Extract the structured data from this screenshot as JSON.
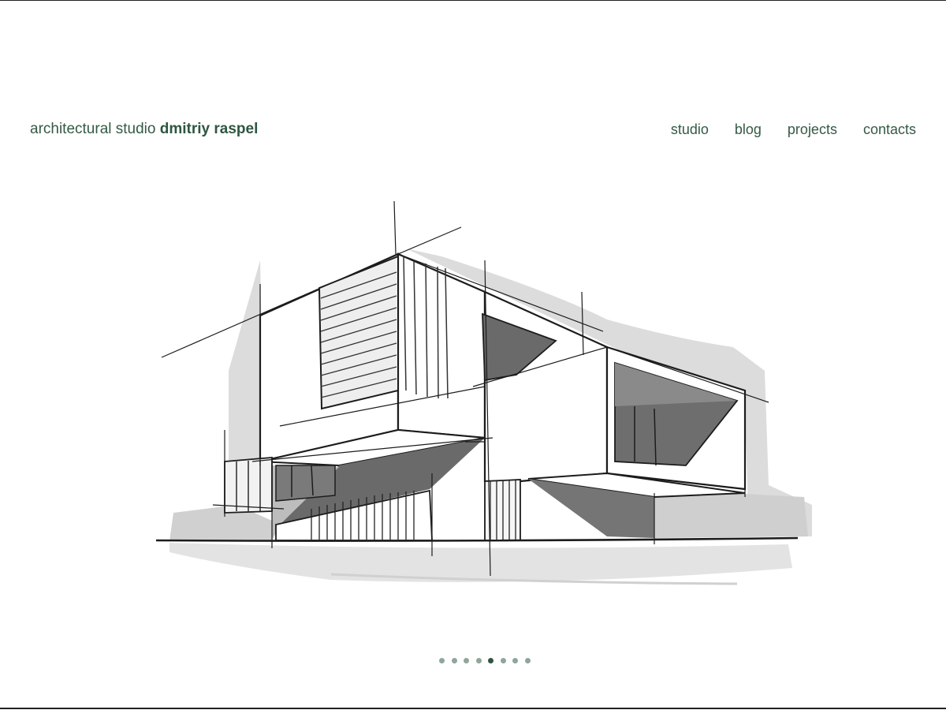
{
  "header": {
    "brand_prefix": "architectural studio",
    "brand_name": "dmitriy raspel",
    "nav": [
      {
        "label": "studio"
      },
      {
        "label": "blog"
      },
      {
        "label": "projects"
      },
      {
        "label": "contacts"
      }
    ]
  },
  "hero": {
    "image": "architectural-sketch-house"
  },
  "slider": {
    "total": 8,
    "active_index": 4
  },
  "colors": {
    "accent": "#2e5640",
    "dot_inactive": "#8fa699",
    "sketch_shade": "#d9d9d9",
    "sketch_dark": "#6a6a6a",
    "ink": "#1c1c1c"
  }
}
